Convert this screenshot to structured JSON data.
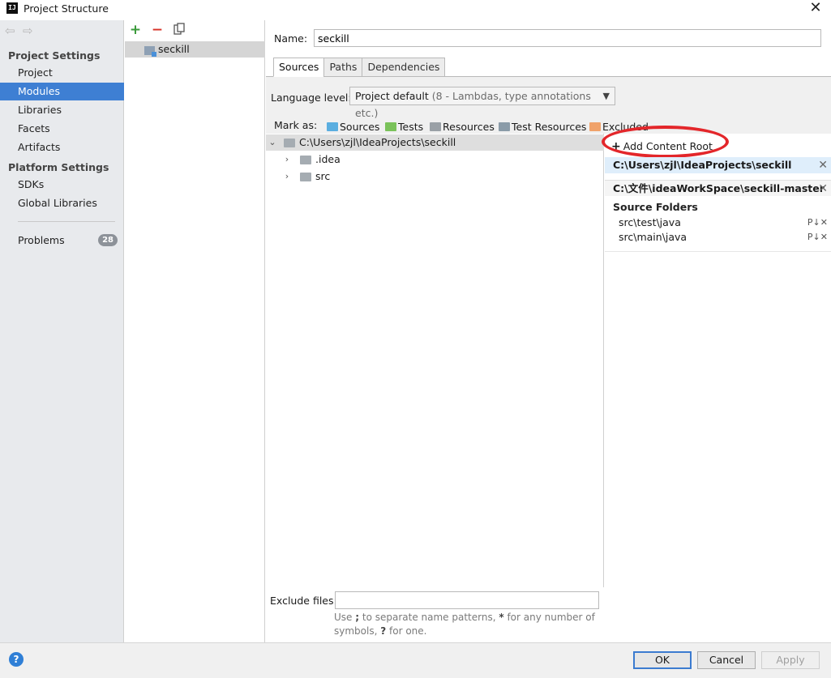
{
  "window": {
    "title": "Project Structure",
    "icon": "intellij-icon",
    "close": "✕"
  },
  "nav": {
    "back_icon": "back-arrow-icon",
    "forward_icon": "forward-arrow-icon",
    "project_settings_title": "Project Settings",
    "project_settings_items": [
      "Project",
      "Modules",
      "Libraries",
      "Facets",
      "Artifacts"
    ],
    "platform_settings_title": "Platform Settings",
    "platform_settings_items": [
      "SDKs",
      "Global Libraries"
    ],
    "problems_label": "Problems",
    "problems_count": "28",
    "selected": "Modules"
  },
  "modules": {
    "toolbar": {
      "add": "+",
      "remove": "−",
      "copy_icon": "copy-icon"
    },
    "items": [
      "seckill"
    ]
  },
  "main": {
    "name_label": "Name:",
    "name_value": "seckill",
    "tabs": [
      "Sources",
      "Paths",
      "Dependencies"
    ],
    "active_tab": "Sources",
    "language_level_label": "Language level:",
    "language_level_value": "Project default",
    "language_level_hint": "(8 - Lambdas, type annotations etc.)",
    "mark_as_label": "Mark as:",
    "mark_as": [
      {
        "label": "Sources",
        "color": "#5aaee0"
      },
      {
        "label": "Tests",
        "color": "#7ac25a"
      },
      {
        "label": "Resources",
        "color": "#9aa0a6"
      },
      {
        "label": "Test Resources",
        "color": "#8a9ba8"
      },
      {
        "label": "Excluded",
        "color": "#f0a26a"
      }
    ],
    "tree": {
      "root": "C:\\Users\\zjl\\IdeaProjects\\seckill",
      "children": [
        ".idea",
        "src"
      ]
    },
    "exclude_files_label": "Exclude files:",
    "exclude_files_value": "",
    "exclude_hint_1": "Use ",
    "exclude_hint_semicolon": ";",
    "exclude_hint_2": " to separate name patterns, ",
    "exclude_hint_star": "*",
    "exclude_hint_3": " for any number of symbols, ",
    "exclude_hint_q": "?",
    "exclude_hint_4": " for one."
  },
  "content_roots": {
    "add_label": "Add Content Root",
    "roots": [
      "C:\\Users\\zjl\\IdeaProjects\\seckill",
      "C:\\文件\\ideaWorkSpace\\seckill-master"
    ],
    "source_folders_title": "Source Folders",
    "source_folders": [
      "src\\test\\java",
      "src\\main\\java"
    ],
    "source_actions": "P↓✕",
    "highlight_color": "#e3262a"
  },
  "footer": {
    "help": "?",
    "ok": "OK",
    "cancel": "Cancel",
    "apply": "Apply"
  }
}
